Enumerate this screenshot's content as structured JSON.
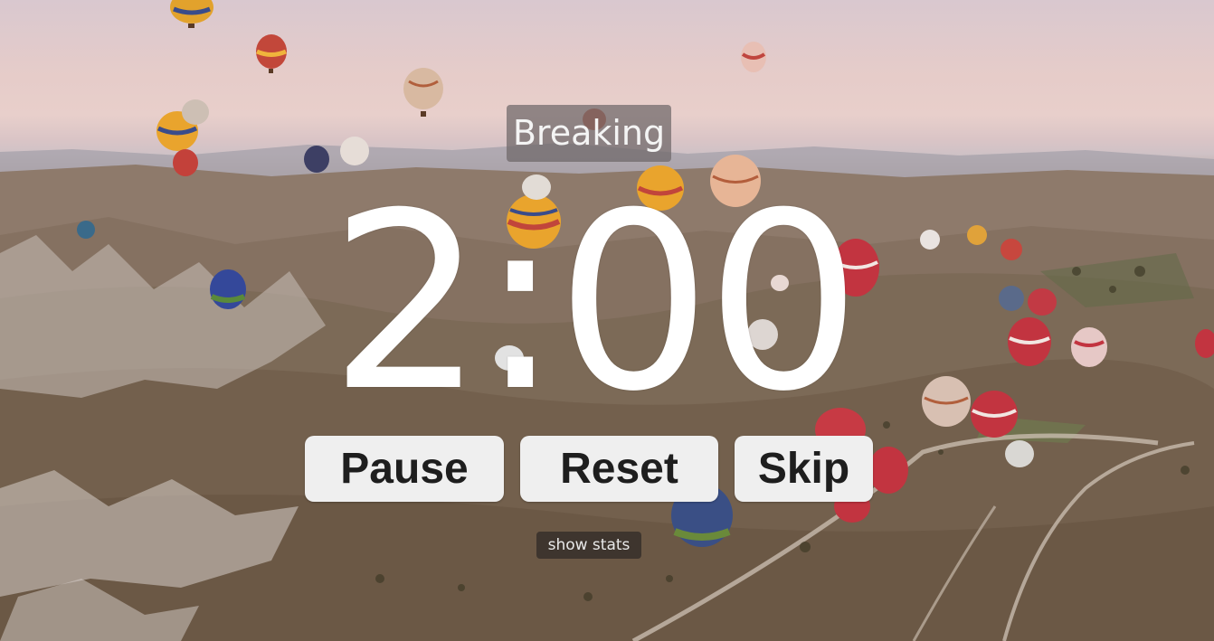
{
  "status": {
    "label": "Breaking"
  },
  "timer": {
    "display": "2:00"
  },
  "controls": {
    "pause_label": "Pause",
    "reset_label": "Reset",
    "skip_label": "Skip",
    "stats_label": "show stats"
  },
  "colors": {
    "button_bg": "#efefef",
    "button_text": "#1e1e1e",
    "timer_text": "#ffffff",
    "label_bg": "#6e6668"
  },
  "background": {
    "subject": "landscape-photo-hot-air-balloons"
  }
}
